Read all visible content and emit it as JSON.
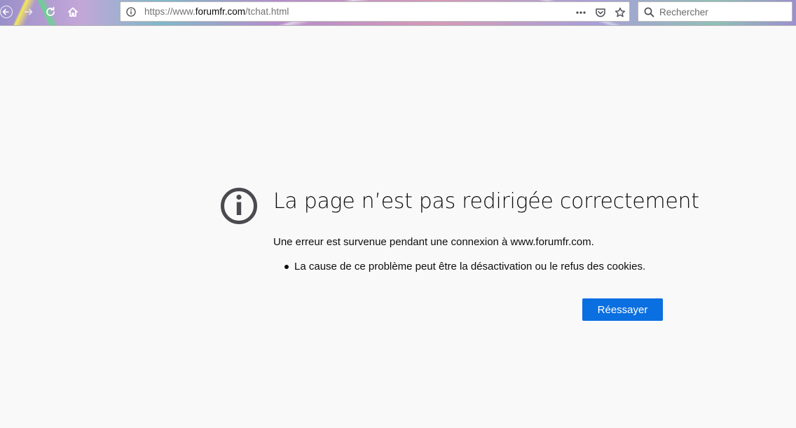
{
  "toolbar": {
    "url_prefix": "https://www.",
    "url_host": "forumfr.com",
    "url_path": "/tchat.html",
    "search_placeholder": "Rechercher"
  },
  "error": {
    "title": "La page n’est pas redirigée correctement",
    "description": "Une erreur est survenue pendant une connexion à www.forumfr.com.",
    "reasons": [
      "La cause de ce problème peut être la désactivation ou le refus des cookies."
    ],
    "retry_label": "Réessayer"
  },
  "icons": {
    "back": "back-arrow-icon",
    "forward": "forward-arrow-icon",
    "reload": "reload-icon",
    "home": "home-icon",
    "site_info": "info-icon",
    "page_actions": "more-dots-icon",
    "pocket": "pocket-icon",
    "bookmark": "star-icon",
    "search": "search-icon",
    "error": "info-circle-icon"
  },
  "colors": {
    "page_background": "#f9f9fa",
    "primary_button": "#0a6fe0",
    "error_icon": "#4a4a4f"
  }
}
